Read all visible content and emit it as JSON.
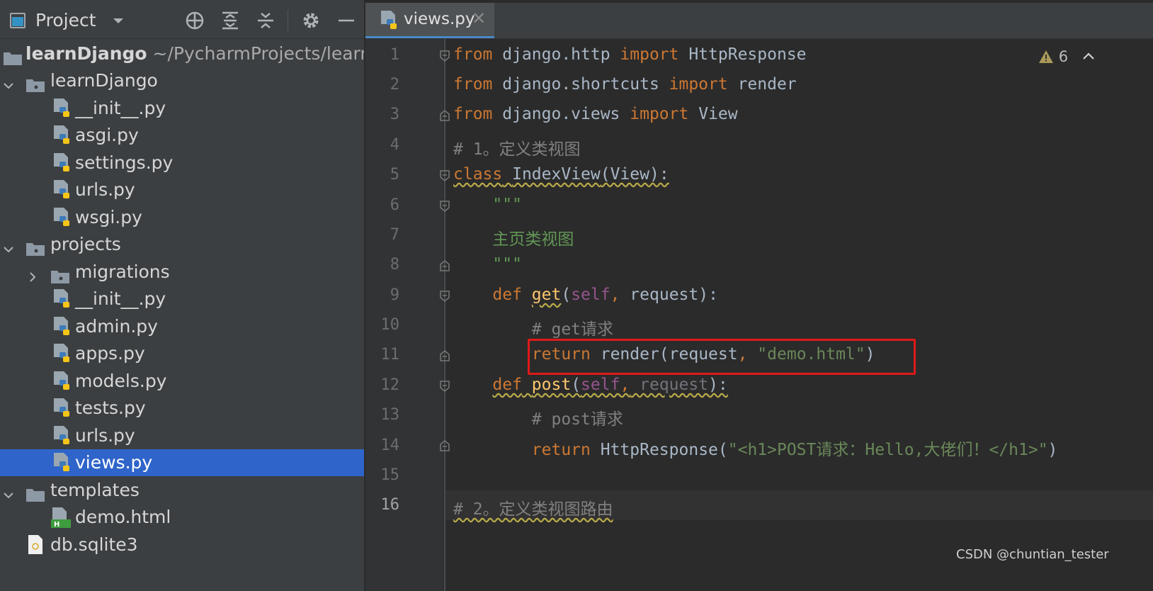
{
  "project_panel": {
    "title": "Project",
    "tree": [
      {
        "label": "learnDjango",
        "suffix": "~/PycharmProjects/learnD",
        "kind": "root"
      },
      {
        "label": "learnDjango",
        "kind": "folder",
        "expanded": true
      },
      {
        "label": "__init__.py",
        "kind": "py"
      },
      {
        "label": "asgi.py",
        "kind": "py"
      },
      {
        "label": "settings.py",
        "kind": "py"
      },
      {
        "label": "urls.py",
        "kind": "py"
      },
      {
        "label": "wsgi.py",
        "kind": "py"
      },
      {
        "label": "projects",
        "kind": "folder",
        "expanded": true
      },
      {
        "label": "migrations",
        "kind": "folder",
        "expanded": false
      },
      {
        "label": "__init__.py",
        "kind": "py"
      },
      {
        "label": "admin.py",
        "kind": "py"
      },
      {
        "label": "apps.py",
        "kind": "py"
      },
      {
        "label": "models.py",
        "kind": "py"
      },
      {
        "label": "tests.py",
        "kind": "py"
      },
      {
        "label": "urls.py",
        "kind": "py"
      },
      {
        "label": "views.py",
        "kind": "py",
        "selected": true
      },
      {
        "label": "templates",
        "kind": "folder",
        "expanded": true
      },
      {
        "label": "demo.html",
        "kind": "html"
      },
      {
        "label": "db.sqlite3",
        "kind": "db"
      }
    ]
  },
  "editor": {
    "tab_label": "views.py",
    "warning_count": "6",
    "line_numbers": [
      "1",
      "2",
      "3",
      "4",
      "5",
      "6",
      "7",
      "8",
      "9",
      "10",
      "11",
      "12",
      "13",
      "14",
      "15",
      "16"
    ],
    "code": {
      "l1": {
        "kw1": "from",
        "mod": " django.http ",
        "kw2": "import",
        "name": " HttpResponse"
      },
      "l2": {
        "kw1": "from",
        "mod": " django.shortcuts ",
        "kw2": "import",
        "name": " render"
      },
      "l3": {
        "kw1": "from",
        "mod": " django.views ",
        "kw2": "import",
        "name": " View"
      },
      "l4": {
        "comment": "# 1。定义类视图"
      },
      "l5": {
        "kw": "class",
        "name": "IndexView",
        "rest": "(View):"
      },
      "l6": {
        "doc": "\"\"\""
      },
      "l7": {
        "doc": "主页类视图"
      },
      "l8": {
        "doc": "\"\"\""
      },
      "l9": {
        "kw": "def",
        "fn": "get",
        "p1": "(",
        "self": "self",
        "comma": ",",
        "rest": " request):"
      },
      "l10": {
        "comment": "# get请求"
      },
      "l11": {
        "kw": "return",
        "call": " render(request",
        "comma": ",",
        "str": " \"demo.html\"",
        "close": ")"
      },
      "l12": {
        "kw": "def",
        "fn": "post",
        "p1": "(",
        "self": "self",
        "comma": ",",
        "rest": " request",
        "close": "):"
      },
      "l13": {
        "comment": "# post请求"
      },
      "l14": {
        "kw": "return",
        "call": " HttpResponse(",
        "str": "\"<h1>POST请求：Hello,大佬们！</h1>\"",
        "close": ")"
      },
      "l16": {
        "comment": "# 2。定义类视图路由"
      }
    }
  },
  "watermark": "CSDN @chuntian_tester",
  "colors": {
    "selection": "#2f65ca",
    "keyword": "#cc7832",
    "function": "#ffc66d",
    "string": "#6a8759",
    "highlight_box": "#e01919"
  }
}
